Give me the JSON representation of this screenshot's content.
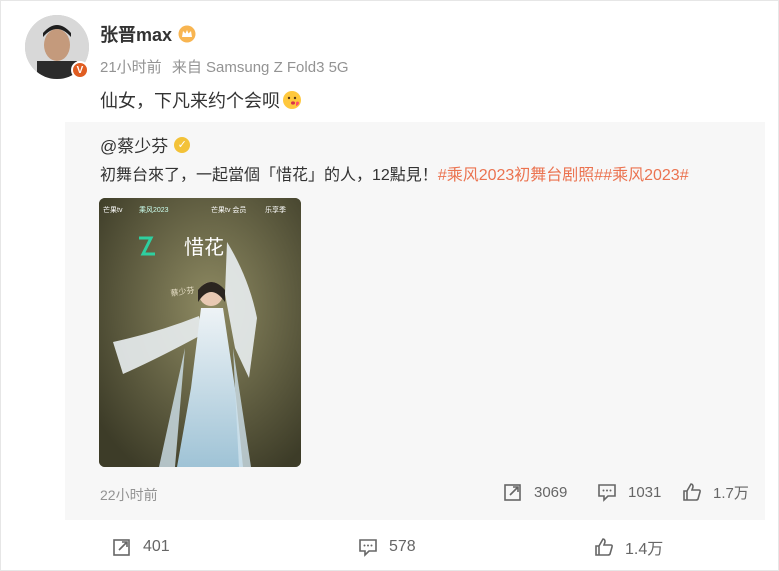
{
  "author": {
    "name": "张晋max",
    "badge": "V",
    "time": "21小时前",
    "source": "来自 Samsung Z Fold3 5G"
  },
  "post": {
    "text": "仙女，下凡来约个会呗"
  },
  "repost": {
    "author": "@蔡少芬",
    "text_plain": "初舞台來了，一起當個「惜花」的人，12點見！",
    "tags": "#乘风2023初舞台剧照##乘风2023#",
    "image": {
      "title": "惜花",
      "signature": "蔡少芬",
      "logos": [
        "芒果tv",
        "乘风2023",
        "芒果tv 会员",
        "乐享季"
      ]
    },
    "time": "22小时前",
    "forward": "3069",
    "comment": "1031",
    "like": "1.7万"
  },
  "actions": {
    "forward": "401",
    "comment": "578",
    "like": "1.4万"
  },
  "colors": {
    "accent": "#eb7350",
    "meta": "#939393",
    "badge_orange": "#e05d22",
    "badge_gold": "#f3c238"
  }
}
